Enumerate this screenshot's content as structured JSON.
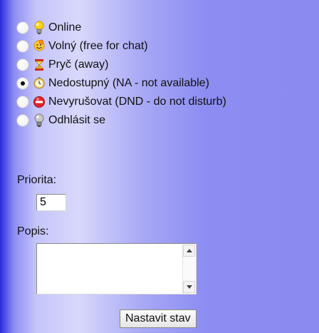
{
  "status": {
    "selected": "na",
    "options": [
      {
        "id": "online",
        "label": "Online",
        "icon": "lightbulb-yellow-icon"
      },
      {
        "id": "chat",
        "label": "Volný (free for chat)",
        "icon": "smiley-icon"
      },
      {
        "id": "away",
        "label": "Pryč (away)",
        "icon": "hourglass-icon"
      },
      {
        "id": "na",
        "label": "Nedostupný (NA - not available)",
        "icon": "clock-icon"
      },
      {
        "id": "dnd",
        "label": "Nevyrušovat (DND - do not disturb)",
        "icon": "no-entry-icon"
      },
      {
        "id": "offline",
        "label": "Odhlásit se",
        "icon": "lightbulb-gray-icon"
      }
    ]
  },
  "priority": {
    "label": "Priorita:",
    "value": "5"
  },
  "description": {
    "label": "Popis:",
    "value": ""
  },
  "submit_label": "Nastavit stav"
}
